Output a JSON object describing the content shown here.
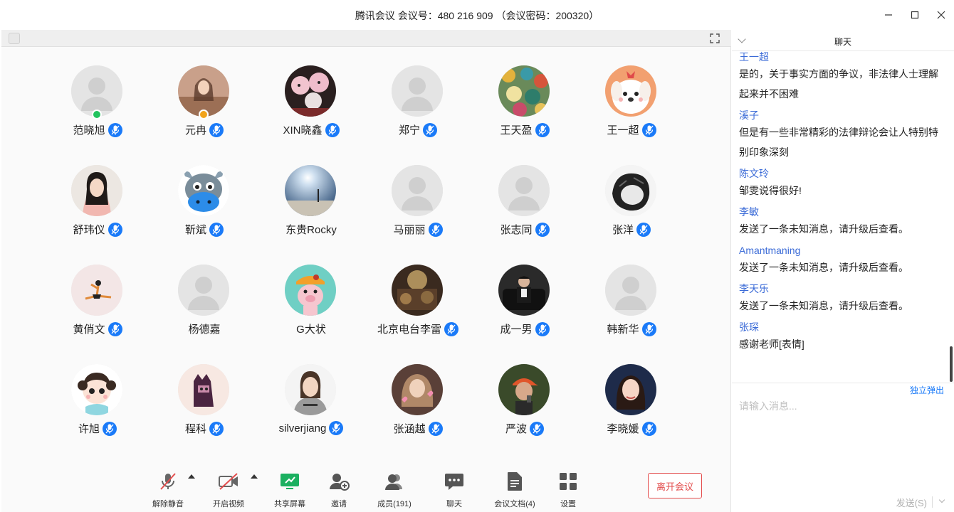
{
  "window": {
    "title": "腾讯会议 会议号：480 216 909 （会议密码：200320）"
  },
  "participants": [
    {
      "name": "范晓旭",
      "avatar": "default",
      "badge": "#21c35e"
    },
    {
      "name": "元冉",
      "avatar": "photo-girl-tan",
      "badge": "#f2a31a"
    },
    {
      "name": "XIN晓鑫",
      "avatar": "photo-pigs"
    },
    {
      "name": "郑宁",
      "avatar": "default"
    },
    {
      "name": "王天盈",
      "avatar": "photo-colorful"
    },
    {
      "name": "王一超",
      "avatar": "cartoon-dog"
    },
    {
      "name": "舒玮仪",
      "avatar": "photo-girl-glasses"
    },
    {
      "name": "靳斌",
      "avatar": "cartoon-cow"
    },
    {
      "name": "东贵Rocky",
      "avatar": "photo-sky"
    },
    {
      "name": "马丽丽",
      "avatar": "default"
    },
    {
      "name": "张志同",
      "avatar": "default"
    },
    {
      "name": "张洋",
      "avatar": "sketch-bw"
    },
    {
      "name": "黄俏文",
      "avatar": "photo-dancer"
    },
    {
      "name": "杨德嘉",
      "avatar": "default"
    },
    {
      "name": "G大状",
      "avatar": "cartoon-pig"
    },
    {
      "name": "北京电台李雷",
      "avatar": "photo-dark"
    },
    {
      "name": "成一男",
      "avatar": "photo-man-sofa"
    },
    {
      "name": "韩新华",
      "avatar": "default"
    },
    {
      "name": "许旭",
      "avatar": "cartoon-girl"
    },
    {
      "name": "程科",
      "avatar": "cartoon-cat"
    },
    {
      "name": "silverjiang",
      "avatar": "photo-girl-hoodie"
    },
    {
      "name": "张涵越",
      "avatar": "photo-girl-hearts"
    },
    {
      "name": "严波",
      "avatar": "photo-man-cap"
    },
    {
      "name": "李晓媛",
      "avatar": "photo-woman"
    }
  ],
  "toolbar": {
    "mute": "解除静音",
    "video": "开启视频",
    "share": "共享屏幕",
    "invite": "邀请",
    "members": "成员(191)",
    "chat": "聊天",
    "docs": "会议文档(4)",
    "settings": "设置",
    "leave": "离开会议"
  },
  "chat": {
    "title": "聊天",
    "messages": [
      {
        "name": "王一超",
        "text": "是的，关于事实方面的争议，非法律人士理解起来并不困难"
      },
      {
        "name": "溪子",
        "text": "但是有一些非常精彩的法律辩论会让人特别特别印象深刻"
      },
      {
        "name": "陈文玲",
        "text": "邹雯说得很好!"
      },
      {
        "name": "李敏",
        "text": "发送了一条未知消息，请升级后查看。"
      },
      {
        "name": "Amantmaning",
        "text": "发送了一条未知消息，请升级后查看。"
      },
      {
        "name": "李天乐",
        "text": "发送了一条未知消息，请升级后查看。"
      },
      {
        "name": "张琛",
        "text": "感谢老师[表情]"
      }
    ],
    "popout": "独立弹出",
    "input_placeholder": "请输入消息...",
    "send": "发送(S)"
  },
  "colors": {
    "accent": "#1a7af8",
    "leave": "#e34d4d",
    "chat_name": "#3b6bd7"
  }
}
